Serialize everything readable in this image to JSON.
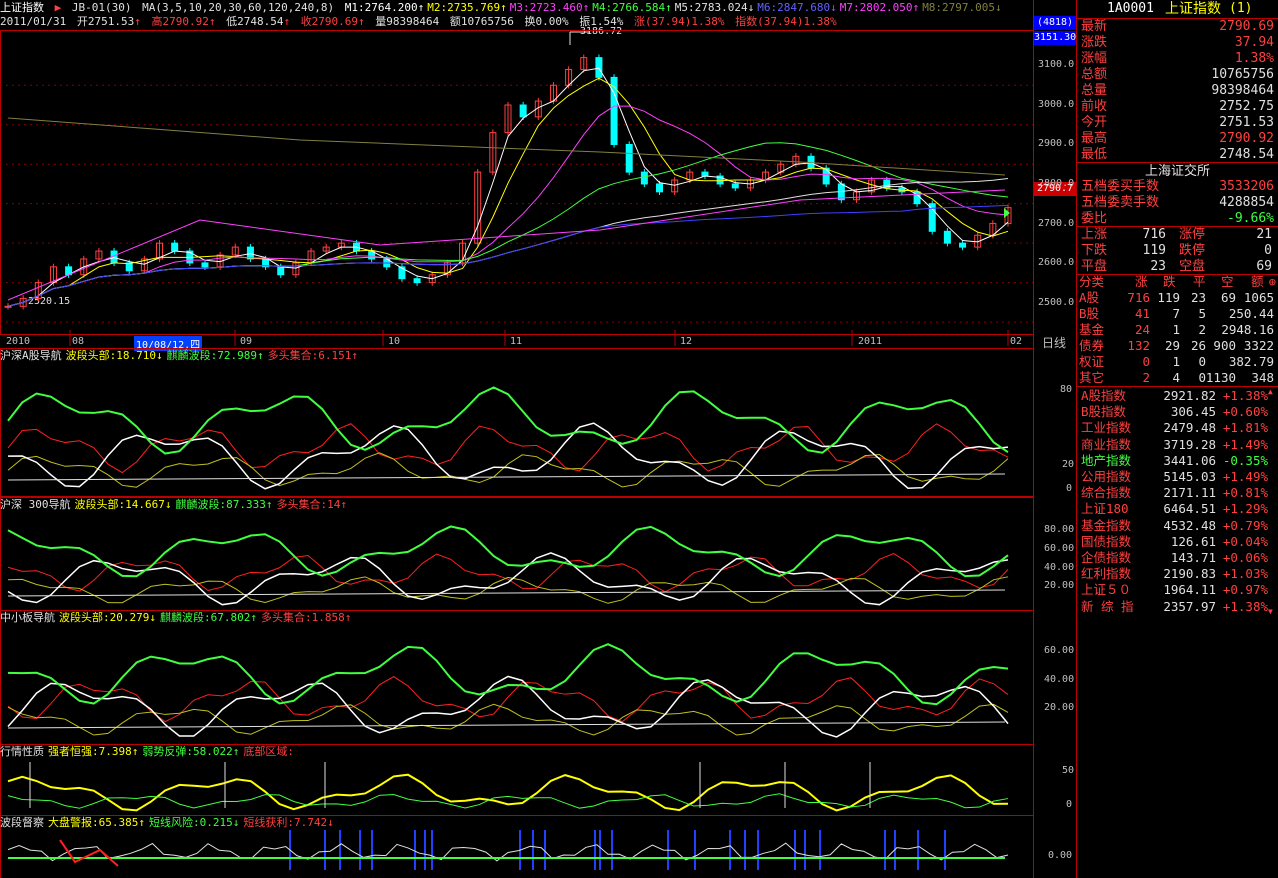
{
  "header": {
    "title": "上证指数",
    "code_sel": "JB-01(30)",
    "ma_label": "MA(3,5,10,20,30,60,120,240,8)",
    "ma": [
      {
        "name": "M1",
        "value": "2764.200",
        "arrow": "↑",
        "color": "#ffffff"
      },
      {
        "name": "M2",
        "value": "2735.769",
        "arrow": "↑",
        "color": "#ffff00"
      },
      {
        "name": "M3",
        "value": "2723.460",
        "arrow": "↑",
        "color": "#ff40ff"
      },
      {
        "name": "M4",
        "value": "2766.584",
        "arrow": "↑",
        "color": "#40ff40"
      },
      {
        "name": "M5",
        "value": "2783.024",
        "arrow": "↓",
        "color": "#e0e0e0"
      },
      {
        "name": "M6",
        "value": "2847.680",
        "arrow": "↓",
        "color": "#6060ff"
      },
      {
        "name": "M7",
        "value": "2802.050",
        "arrow": "↑",
        "color": "#ff40ff"
      },
      {
        "name": "M8",
        "value": "2797.005",
        "arrow": "↓",
        "color": "#808040"
      }
    ],
    "date": "2011/01/31",
    "open": "开2751.53",
    "high": "高2790.92",
    "low": "低2748.54",
    "close": "收2790.69",
    "vol": "量98398464",
    "amt": "额10765756",
    "turnover": "换0.00%",
    "amp": "振1.54%",
    "chg": "涨(37.94)1.38%",
    "idx": "指数(37.94)1.38%"
  },
  "chart_data": {
    "type": "line",
    "price_ticks": [
      "3100.0",
      "3000.0",
      "2900.0",
      "2800.0",
      "2700.0",
      "2600.0",
      "2500.0"
    ],
    "price_range": [
      2480,
      3240
    ],
    "price_hi_label": "3186.72",
    "price_lo_label": "2520.15",
    "last_price_tag": "2790.7",
    "top_badge_1": "(4818)",
    "top_badge_2": "3151.30",
    "x_labels": [
      "2010",
      "08",
      "10/08/12,四",
      "09",
      "10",
      "11",
      "12",
      "2011",
      "02"
    ],
    "period": "日线",
    "close": [
      2540,
      2560,
      2600,
      2640,
      2620,
      2660,
      2680,
      2650,
      2630,
      2660,
      2700,
      2680,
      2650,
      2640,
      2670,
      2690,
      2660,
      2640,
      2620,
      2650,
      2680,
      2690,
      2700,
      2680,
      2660,
      2640,
      2610,
      2600,
      2620,
      2650,
      2700,
      2880,
      2980,
      3050,
      3020,
      3060,
      3100,
      3140,
      3170,
      3120,
      2950,
      2880,
      2850,
      2830,
      2860,
      2880,
      2870,
      2850,
      2840,
      2860,
      2880,
      2900,
      2920,
      2890,
      2850,
      2810,
      2830,
      2860,
      2840,
      2830,
      2800,
      2730,
      2700,
      2690,
      2720,
      2750,
      2790
    ],
    "panels": [
      {
        "title": "沪深A股导航",
        "a_label": "波段头部:18.710",
        "a_arrow": "↓",
        "b_label": "麒麟波段:72.989",
        "b_arrow": "↑",
        "c_label": "多头集合:6.151",
        "c_arrow": "↑",
        "ticks": [
          "80",
          "20",
          "0"
        ]
      },
      {
        "title": "沪深 300导航",
        "a_label": "波段头部:14.667",
        "a_arrow": "↓",
        "b_label": "麒麟波段:87.333",
        "b_arrow": "↑",
        "c_label": "多头集合:14",
        "c_arrow": "↑",
        "ticks": [
          "80.00",
          "60.00",
          "40.00",
          "20.00"
        ]
      },
      {
        "title": "中小板导航",
        "a_label": "波段头部:20.279",
        "a_arrow": "↓",
        "b_label": "麒麟波段:67.802",
        "b_arrow": "↑",
        "c_label": "多头集合:1.858",
        "c_arrow": "↑",
        "ticks": [
          "60.00",
          "40.00",
          "20.00"
        ]
      },
      {
        "title": "行情性质",
        "a_label": "强者恒强:7.398",
        "a_arrow": "↑",
        "b_label": "弱势反弹:58.022",
        "b_arrow": "↑",
        "c_label": "底部区域:",
        "c_arrow": "",
        "ticks": [
          "50",
          "0"
        ]
      },
      {
        "title": "波段督察",
        "a_label": "大盘警报:65.385",
        "a_arrow": "↑",
        "b_label": "短线风险:0.215",
        "b_arrow": "↓",
        "c_label": "短线获利:7.742",
        "c_arrow": "↓",
        "ticks": [
          "0.00"
        ]
      }
    ]
  },
  "side": {
    "code": "1A0001",
    "name": "上证指数",
    "suffix": "(1)",
    "quote": [
      {
        "k": "最新",
        "v": "2790.69",
        "c": "#ff4040"
      },
      {
        "k": "涨跌",
        "v": "37.94",
        "c": "#ff4040"
      },
      {
        "k": "涨幅",
        "v": "1.38%",
        "c": "#ff4040"
      },
      {
        "k": "总额",
        "v": "10765756",
        "c": "#e0e0e0"
      },
      {
        "k": "总量",
        "v": "98398464",
        "c": "#e0e0e0"
      },
      {
        "k": "前收",
        "v": "2752.75",
        "c": "#e0e0e0"
      },
      {
        "k": "今开",
        "v": "2751.53",
        "c": "#e0e0e0"
      },
      {
        "k": "最高",
        "v": "2790.92",
        "c": "#ff4040"
      },
      {
        "k": "最低",
        "v": "2748.54",
        "c": "#e0e0e0"
      }
    ],
    "exchange": "上海证交所",
    "book": [
      {
        "k": "五档委买手数",
        "v": "3533206",
        "c": "#ff4040"
      },
      {
        "k": "五档委卖手数",
        "v": "4288854",
        "c": "#e0e0e0"
      },
      {
        "k": "委比",
        "v": "-9.66%",
        "c": "#40ff40"
      }
    ],
    "breadth": [
      {
        "k1": "上涨",
        "v1": "716",
        "k2": "涨停",
        "v2": "21"
      },
      {
        "k1": "下跌",
        "v1": "119",
        "k2": "跌停",
        "v2": "0"
      },
      {
        "k1": "平盘",
        "v1": "23",
        "k2": "空盘",
        "v2": "69"
      }
    ],
    "cat_head": [
      "分类",
      "涨",
      "跌",
      "平",
      "空",
      "额"
    ],
    "cats": [
      [
        "A股",
        "716",
        "119",
        "23",
        "69",
        "1065"
      ],
      [
        "B股",
        "41",
        "7",
        "5",
        "",
        "250.44"
      ],
      [
        "基金",
        "24",
        "1",
        "2",
        "",
        "2948.16"
      ],
      [
        "债券",
        "132",
        "29",
        "26",
        "900",
        "3322"
      ],
      [
        "权证",
        "0",
        "1",
        "0",
        "",
        "382.79"
      ],
      [
        "其它",
        "2",
        "4",
        "0",
        "1130",
        "348"
      ]
    ],
    "indices": [
      {
        "name": "A股指数",
        "value": "2921.82",
        "chg": "+1.38%",
        "c": "#ff4040"
      },
      {
        "name": "B股指数",
        "value": "306.45",
        "chg": "+0.60%",
        "c": "#ff4040"
      },
      {
        "name": "工业指数",
        "value": "2479.48",
        "chg": "+1.81%",
        "c": "#ff4040"
      },
      {
        "name": "商业指数",
        "value": "3719.28",
        "chg": "+1.49%",
        "c": "#ff4040"
      },
      {
        "name": "地产指数",
        "value": "3441.06",
        "chg": "-0.35%",
        "c": "#40ff40"
      },
      {
        "name": "公用指数",
        "value": "5145.03",
        "chg": "+1.49%",
        "c": "#ff4040"
      },
      {
        "name": "综合指数",
        "value": "2171.11",
        "chg": "+0.81%",
        "c": "#ff4040"
      },
      {
        "name": "上证180",
        "value": "6464.51",
        "chg": "+1.29%",
        "c": "#ff4040"
      },
      {
        "name": "基金指数",
        "value": "4532.48",
        "chg": "+0.79%",
        "c": "#ff4040"
      },
      {
        "name": "国债指数",
        "value": "126.61",
        "chg": "+0.04%",
        "c": "#ff4040"
      },
      {
        "name": "企债指数",
        "value": "143.71",
        "chg": "+0.06%",
        "c": "#ff4040"
      },
      {
        "name": "红利指数",
        "value": "2190.83",
        "chg": "+1.03%",
        "c": "#ff4040"
      },
      {
        "name": "上证５０",
        "value": "1964.11",
        "chg": "+0.97%",
        "c": "#ff4040"
      },
      {
        "name": "新 综 指",
        "value": "2357.97",
        "chg": "+1.38%",
        "c": "#ff4040"
      }
    ]
  }
}
